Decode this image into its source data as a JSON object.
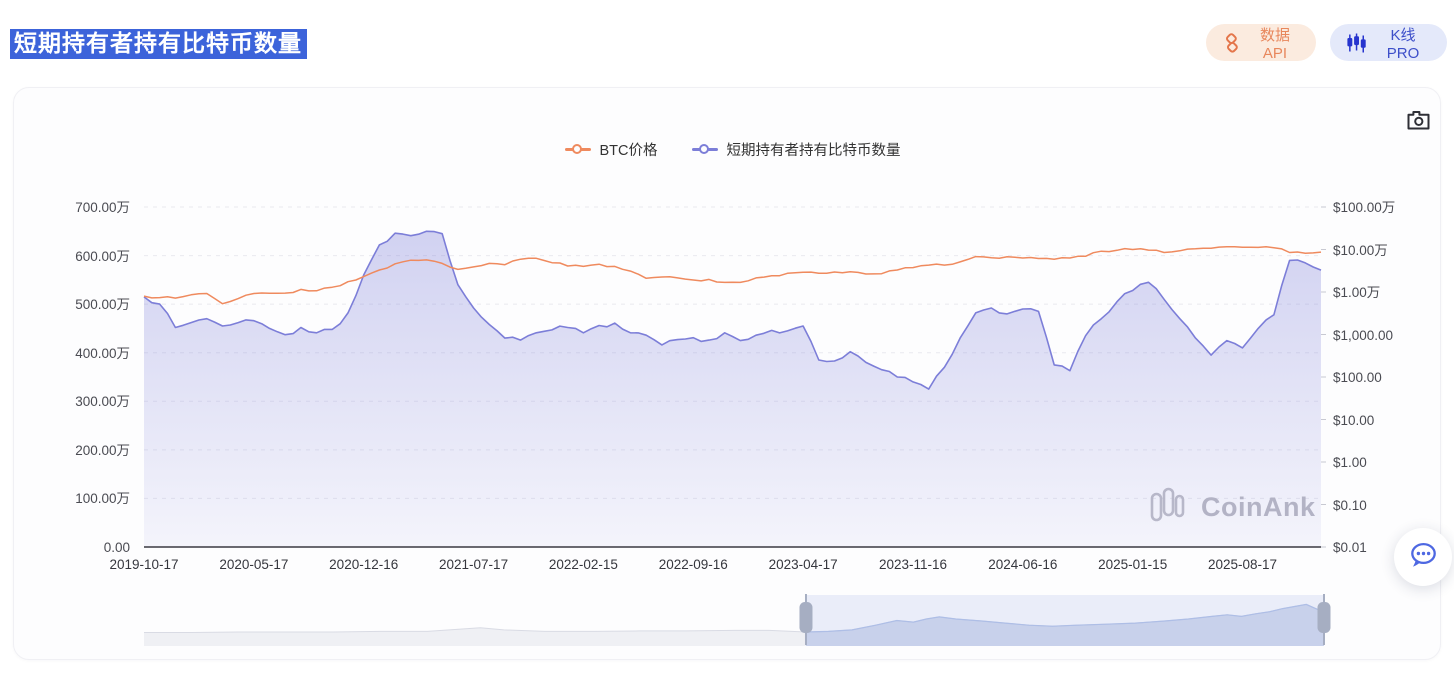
{
  "header": {
    "title": "短期持有者持有比特币数量",
    "api_button": {
      "label": "数据API",
      "icon": "api-knot-icon",
      "text_color": "#E8875C",
      "bg_color": "#FBEBDF"
    },
    "kline_button": {
      "label": "K线 PRO",
      "icon": "candlestick-icon",
      "text_color": "#3D4FC9",
      "bg_color": "#E4E9FA"
    }
  },
  "card": {
    "watermark": "CoinAnk",
    "camera_icon": "camera-icon",
    "chat_icon": "chat-bubble-icon"
  },
  "chart_data": {
    "type": "area",
    "title": "短期持有者持有比特币数量",
    "legend_position": "top-center",
    "grid": "dashed-horizontal",
    "x_start_month": "2019-10",
    "x_interval": "1 month",
    "x_months_span": 75,
    "x_tick_labels": [
      "2019-10-17",
      "2020-05-17",
      "2020-12-16",
      "2021-07-17",
      "2022-02-15",
      "2022-09-16",
      "2023-04-17",
      "2023-11-16",
      "2024-06-16",
      "2025-01-15",
      "2025-08-17"
    ],
    "left_axis": {
      "tick_labels": [
        "700.00万",
        "600.00万",
        "500.00万",
        "400.00万",
        "300.00万",
        "200.00万",
        "100.00万",
        "0.00"
      ],
      "max_wan": 700,
      "min_wan": 0,
      "scale": "linear",
      "unit": "万枚 BTC"
    },
    "right_axis": {
      "tick_labels": [
        "$100.00万",
        "$10.00万",
        "$1.00万",
        "$1,000.00",
        "$100.00",
        "$10.00",
        "$1.00",
        "$0.10",
        "$0.01"
      ],
      "min": 0.01,
      "max": 1000000,
      "scale": "log",
      "unit": "USD"
    },
    "series": [
      {
        "name": "BTC价格",
        "type": "line",
        "axis": "right",
        "color": "#EF8A5E",
        "unit": "USD",
        "values_monthly": [
          8000,
          7400,
          7200,
          8600,
          9200,
          5300,
          7000,
          9200,
          9300,
          9400,
          11500,
          10700,
          13000,
          17500,
          23000,
          33000,
          46000,
          56000,
          57000,
          47000,
          34000,
          39000,
          47000,
          44000,
          59000,
          62000,
          49000,
          41000,
          40000,
          45000,
          40000,
          31000,
          21000,
          22500,
          21500,
          19200,
          19800,
          16800,
          16800,
          21500,
          24000,
          27500,
          29000,
          27500,
          29500,
          29800,
          26500,
          27000,
          33000,
          37500,
          43000,
          43000,
          51000,
          68000,
          64000,
          67500,
          63000,
          61500,
          59000,
          63000,
          69000,
          91000,
          96000,
          100000,
          97000,
          85000,
          93000,
          104000,
          107000,
          116000,
          113000,
          112000,
          110000,
          85000,
          82000,
          87000
        ]
      },
      {
        "name": "短期持有者持有比特币数量",
        "type": "area",
        "axis": "left",
        "color": "#7C7ED8",
        "fill_top": "rgba(124,126,216,0.34)",
        "fill_bottom": "rgba(124,126,216,0.07)",
        "unit": "万枚",
        "values_monthly": [
          515,
          500,
          452,
          462,
          470,
          455,
          462,
          466,
          450,
          437,
          452,
          441,
          448,
          482,
          560,
          622,
          646,
          641,
          650,
          645,
          540,
          492,
          458,
          430,
          426,
          441,
          447,
          452,
          441,
          456,
          461,
          441,
          436,
          416,
          427,
          431,
          426,
          441,
          425,
          436,
          446,
          445,
          455,
          385,
          383,
          402,
          380,
          365,
          350,
          340,
          325,
          370,
          430,
          482,
          492,
          480,
          490,
          485,
          375,
          363,
          435,
          470,
          505,
          528,
          545,
          510,
          470,
          430,
          395,
          425,
          410,
          450,
          478,
          590,
          585,
          570
        ]
      }
    ],
    "datazoom": {
      "window_start_frac": 0.561,
      "window_end_frac": 1.0,
      "handle_color": "#A6AEC2",
      "selection_fill": "rgba(112,134,213,0.13)",
      "preview": [
        [
          0.0,
          0.26
        ],
        [
          0.04,
          0.26
        ],
        [
          0.08,
          0.27
        ],
        [
          0.12,
          0.27
        ],
        [
          0.16,
          0.27
        ],
        [
          0.2,
          0.28
        ],
        [
          0.24,
          0.28
        ],
        [
          0.265,
          0.32
        ],
        [
          0.285,
          0.35
        ],
        [
          0.305,
          0.31
        ],
        [
          0.34,
          0.28
        ],
        [
          0.38,
          0.28
        ],
        [
          0.42,
          0.29
        ],
        [
          0.46,
          0.29
        ],
        [
          0.5,
          0.3
        ],
        [
          0.53,
          0.3
        ],
        [
          0.561,
          0.27
        ],
        [
          0.58,
          0.28
        ],
        [
          0.6,
          0.31
        ],
        [
          0.62,
          0.4
        ],
        [
          0.638,
          0.49
        ],
        [
          0.652,
          0.46
        ],
        [
          0.663,
          0.52
        ],
        [
          0.674,
          0.56
        ],
        [
          0.688,
          0.52
        ],
        [
          0.71,
          0.48
        ],
        [
          0.73,
          0.44
        ],
        [
          0.75,
          0.4
        ],
        [
          0.77,
          0.38
        ],
        [
          0.79,
          0.4
        ],
        [
          0.815,
          0.42
        ],
        [
          0.84,
          0.44
        ],
        [
          0.865,
          0.48
        ],
        [
          0.885,
          0.52
        ],
        [
          0.905,
          0.57
        ],
        [
          0.918,
          0.6
        ],
        [
          0.93,
          0.57
        ],
        [
          0.942,
          0.62
        ],
        [
          0.954,
          0.66
        ],
        [
          0.965,
          0.72
        ],
        [
          0.975,
          0.76
        ],
        [
          0.985,
          0.8
        ],
        [
          0.993,
          0.72
        ],
        [
          1.0,
          0.65
        ]
      ]
    }
  }
}
